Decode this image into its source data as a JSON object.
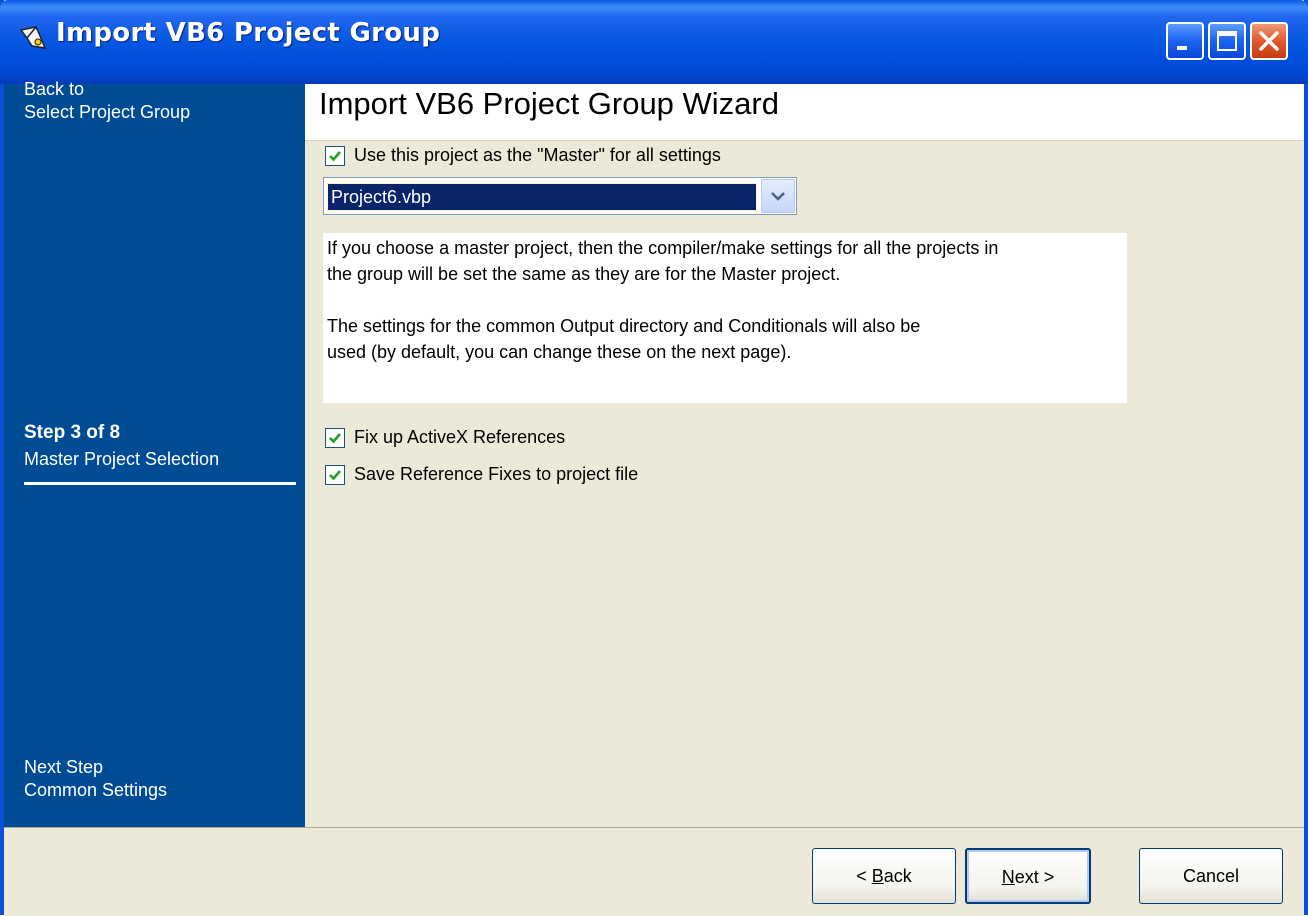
{
  "window": {
    "title": "Import VB6 Project Group",
    "controls": [
      "minimize-icon",
      "maximize-icon",
      "close-icon"
    ]
  },
  "sidebar": {
    "back_label_1": "Back to",
    "back_label_2": "Select Project Group",
    "step_label": "Step 3 of 8",
    "step_name": "Master Project Selection",
    "next_label_1": "Next Step",
    "next_label_2": "Common Settings"
  },
  "header": {
    "title": "Import VB6 Project Group Wizard"
  },
  "options": {
    "use_master": {
      "label": "Use this project as the \"Master\" for all settings",
      "checked": true
    },
    "master_project": {
      "selected": "Project6.vbp"
    },
    "fix_activex": {
      "label": "Fix up ActiveX References",
      "checked": true
    },
    "save_fixes": {
      "label": "Save Reference Fixes to project file",
      "checked": true
    }
  },
  "info": {
    "para1_line1": "If you choose a master project, then the compiler/make settings for all the projects in",
    "para1_line2": "the group will be set the same as they are for the Master project.",
    "para2_line1": "The settings for the common Output directory and Conditionals will also be",
    "para2_line2": "used (by default, you can change these on the next page)."
  },
  "footer": {
    "back_prefix": "< ",
    "back_key": "B",
    "back_rest": "ack",
    "next_key": "N",
    "next_rest": "ext >",
    "cancel": "Cancel"
  },
  "colors": {
    "titlebar": "#0054e3",
    "sidebar": "#004c94",
    "dialog_bg": "#ece9d8",
    "selection": "#0a246a"
  }
}
